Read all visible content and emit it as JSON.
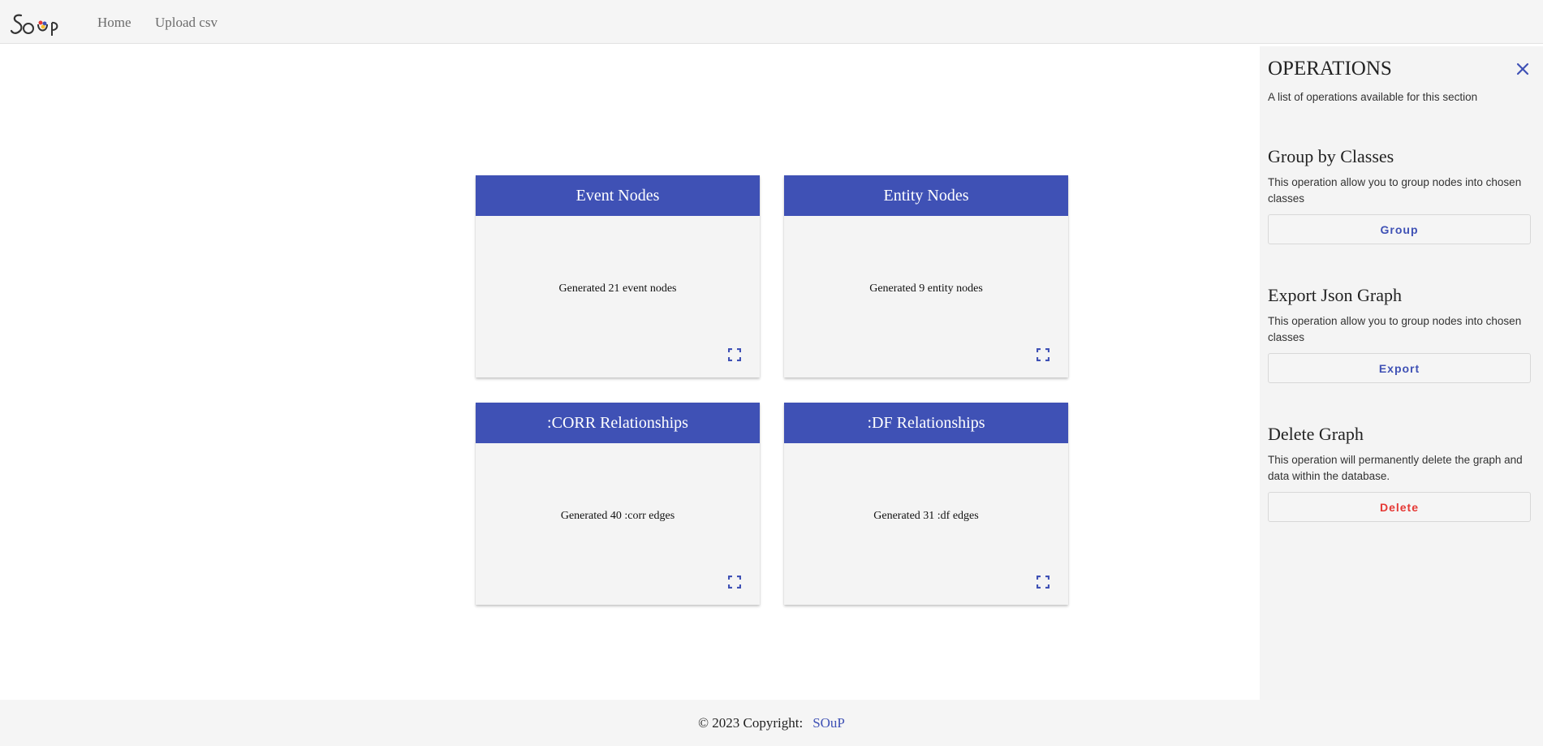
{
  "navbar": {
    "logo_icon": "soup-logo-icon",
    "links": [
      {
        "label": "Home"
      },
      {
        "label": "Upload csv"
      }
    ]
  },
  "cards": [
    {
      "title": "Event Nodes",
      "text": "Generated 21 event nodes",
      "action_icon": "fullscreen-icon"
    },
    {
      "title": "Entity Nodes",
      "text": "Generated 9 entity nodes",
      "action_icon": "fullscreen-icon"
    },
    {
      "title": ":CORR Relationships",
      "text": "Generated 40 :corr edges",
      "action_icon": "fullscreen-icon"
    },
    {
      "title": ":DF Relationships",
      "text": "Generated 31 :df edges",
      "action_icon": "fullscreen-icon"
    }
  ],
  "operations": {
    "title": "OPERATIONS",
    "subtitle": "A list of operations available for this section",
    "close_icon": "close-icon",
    "items": [
      {
        "title": "Group by Classes",
        "description": "This operation allow you to group nodes into chosen classes",
        "button": "Group"
      },
      {
        "title": "Export Json Graph",
        "description": "This operation allow you to group nodes into chosen classes",
        "button": "Export"
      },
      {
        "title": "Delete Graph",
        "description": "This operation will permanently delete the graph and data within the database.",
        "button": "Delete"
      }
    ]
  },
  "footer": {
    "copyright": "© 2023 Copyright:",
    "link": "SOuP"
  },
  "colors": {
    "primary": "#3f51b5",
    "danger": "#e53935",
    "panel_bg": "#f4f4f4"
  }
}
